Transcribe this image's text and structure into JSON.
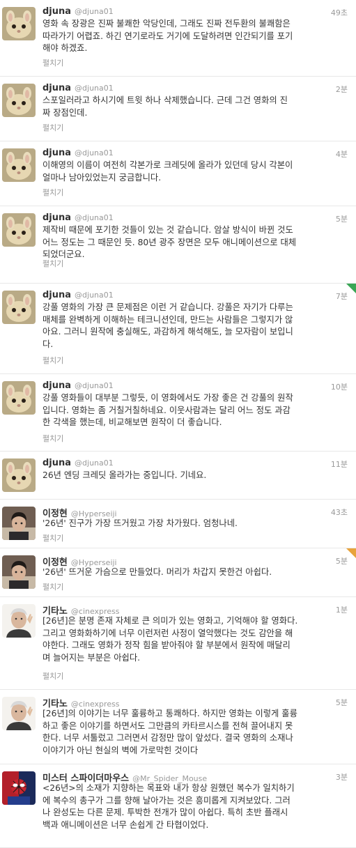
{
  "expand_label": "펼치기",
  "tweets": [
    {
      "name": "djuna",
      "handle": "@djuna01",
      "time": "49초",
      "avatar": "bunny",
      "lines": [
        "영화 속 장광은 진짜 불쾌한 악당인데, 그래도 진짜 전두환의 불쾌함은",
        "따라가기 어렵죠. 하긴 연기로라도 거기에 도달하려면 인간되기를 포기",
        "해야 하겠죠."
      ]
    },
    {
      "name": "djuna",
      "handle": "@djuna01",
      "time": "2분",
      "avatar": "bunny",
      "lines": [
        "스포일러라고 하시기에 트윗 하나 삭제했습니다. 근데 그건 영화의 진",
        "짜 장점인데."
      ]
    },
    {
      "name": "djuna",
      "handle": "@djuna01",
      "time": "4분",
      "avatar": "bunny",
      "lines": [
        "이해영의 이름이 여전히 각본가로 크레딧에 올라가 있던데 당시 각본이",
        "얼마나 남아있었는지 궁금합니다."
      ]
    },
    {
      "name": "djuna",
      "handle": "@djuna01",
      "time": "5분",
      "avatar": "bunny",
      "lines": [
        "제작비 때문에 포기한 것들이 있는 것 같습니다. 암살 방식이 바뀐 것도",
        "어느 정도는 그 때문인 듯. 80년 광주 장면은 모두 애니메이션으로 대체",
        "되었더군요."
      ]
    },
    {
      "name": "djuna",
      "handle": "@djuna01",
      "time": "7분",
      "avatar": "bunny",
      "corner": "#3aa655",
      "lines": [
        "강풀 영화의 가장 큰 문제점은 이런 거 같습니다. 강풀은 자기가 다루는",
        "매체를 완벽하게 이해하는 테크니션인데, 만드는 사람들은 그렇지가 않",
        "아요. 그러니 원작에 충실해도, 과감하게 해석해도, 늘 모자람이 보입니",
        "다."
      ]
    },
    {
      "name": "djuna",
      "handle": "@djuna01",
      "time": "10분",
      "avatar": "bunny",
      "lines": [
        "강풀 영화들이 대부분 그렇듯, 이 영화에서도 가장 좋은 건 강풀의 원작",
        "입니다. 영화는 좀 거칠거칠하네요. 이웃사람과는 달리 어느 정도 과감",
        "한 각색을 했는데, 비교해보면 원작이 더 좋습니다."
      ]
    },
    {
      "name": "djuna",
      "handle": "@djuna01",
      "time": "11분",
      "avatar": "bunny",
      "lines": [
        "26년 엔딩 크레딧 올라가는 중입니다. 기네요."
      ]
    },
    {
      "name": "이정현",
      "handle": "@Hyperseiji",
      "time": "43초",
      "avatar": "man",
      "lines": [
        "'26년' 진구가 가장 뜨거웠고 가장 차가웠다. 엄청나네."
      ]
    },
    {
      "name": "이정현",
      "handle": "@Hyperseiji",
      "time": "5분",
      "avatar": "man",
      "corner": "#e8a33c",
      "lines": [
        "'26년' 뜨거운 가슴으로 만들었다. 머리가 차갑지 못한건 아쉽다."
      ]
    },
    {
      "name": "기타노",
      "handle": "@cinexpress",
      "time": "1분",
      "avatar": "kitano",
      "lines": [
        "[26년]은 분명 존재 자체로 큰 의미가 있는 영화고, 기억해야 할 영화다.",
        "그리고 영화화하기에 너무 이런저런 사정이 열악했다는 것도 감안을 해",
        "야한다. 그래도 영화가 정작 힘을 받아줘야 할 부분에서 원작에 매달리",
        "며 늘어지는 부분은 아쉽다."
      ]
    },
    {
      "name": "기타노",
      "handle": "@cinexpress",
      "time": "5분",
      "avatar": "kitano",
      "lines": [
        "[26년]의 이야기는 너무 훌륭하고 통쾌하다. 하지만 영화는 이렇게 훌륭",
        "하고 좋은 이야기를 하면서도 그만큼의 카타르시스를 전혀 끌어내지 못",
        "한다. 너무 서툴렀고 그러면서 감정만 많이 앞섰다. 결국 영화의 소재나",
        "이야기가 아닌 현실의 벽에 가로막힌 것이다"
      ]
    },
    {
      "name": "미스터 스파이더마우스",
      "handle": "@Mr_Spider_Mouse",
      "time": "3분",
      "avatar": "spider",
      "lines": [
        "<26년>의 소재가 지향하는 목표와 내가 항상 원했던 복수가 일치하기",
        "에 복수의 총구가 그를 향해 날아가는 것은 흥미롭게 지켜보았다. 그러",
        "나 완성도는 다른 문제. 투박한 전개가 많이 아쉽다. 특히 초반 플래시",
        "백과 애니메이션은 너무 손쉽게 간 타협이었다."
      ]
    }
  ]
}
